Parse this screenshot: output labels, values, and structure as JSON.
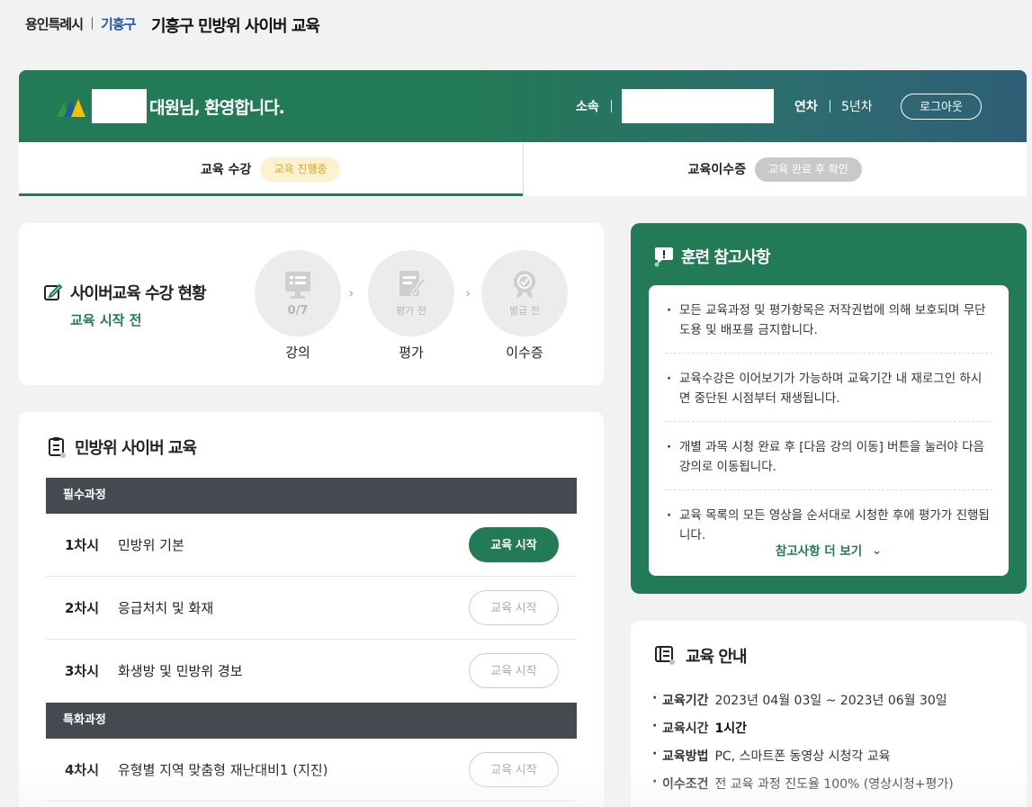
{
  "header": {
    "city_logo": "용인특례시",
    "district": "기흥구",
    "site_title": "기흥구 민방위 사이버 교육"
  },
  "banner": {
    "welcome": "대원님, 환영합니다.",
    "affiliation_label": "소속",
    "year_label": "연차",
    "year_value": "5년차",
    "logout_label": "로그아웃"
  },
  "tabs": [
    {
      "label": "교육 수강",
      "badge": "교육 진행중"
    },
    {
      "label": "교육이수증",
      "badge": "교육 완료 후 확인"
    }
  ],
  "status": {
    "title": "사이버교육 수강 현황",
    "subtitle": "교육 시작 전",
    "steps": [
      {
        "circle_text": "0/7",
        "label": "강의"
      },
      {
        "circle_text": "평가 전",
        "label": "평가"
      },
      {
        "circle_text": "발급 전",
        "label": "이수증"
      }
    ]
  },
  "education": {
    "title": "민방위 사이버 교육",
    "categories": [
      "필수과정",
      "특화과정"
    ],
    "rows": [
      {
        "num": "1차시",
        "name": "민방위 기본",
        "button": "교육 시작"
      },
      {
        "num": "2차시",
        "name": "응급처치 및 화재",
        "button": "교육 시작"
      },
      {
        "num": "3차시",
        "name": "화생방 및 민방위 경보",
        "button": "교육 시작"
      },
      {
        "num": "4차시",
        "name": "유형별 지역 맞춤형 재난대비1 (지진)",
        "button": "교육 시작"
      }
    ]
  },
  "reference": {
    "title": "훈련 참고사항",
    "items": [
      "모든 교육과정 및 평가항목은 저작권법에 의해 보호되며 무단 도용 및 배포를 금지합니다.",
      "교육수강은 이어보기가 가능하며 교육기간 내 재로그인 하시면 중단된 시점부터 재생됩니다.",
      "개별 과목 시청 완료 후 [다음 강의 이동] 버튼을 눌러야 다음 강의로 이동됩니다.",
      "교육 목록의 모든 영상을 순서대로 시청한 후에 평가가 진행됩니다."
    ],
    "more": "참고사항 더 보기"
  },
  "info": {
    "title": "교육 안내",
    "rows": [
      {
        "key": "교육기간",
        "value": "2023년 04월 03일 ~ 2023년 06월 30일"
      },
      {
        "key": "교육시간",
        "value": "1시간"
      },
      {
        "key": "교육방법",
        "value": "PC, 스마트폰 동영상 시청각 교육"
      },
      {
        "key": "이수조건",
        "value": "전 교육 과정 진도율 100% (영상시청+평가)"
      }
    ]
  },
  "colors": {
    "primary": "#237a56",
    "badge_yellow": "#fdf1cf",
    "category_bg": "#444a4f"
  }
}
